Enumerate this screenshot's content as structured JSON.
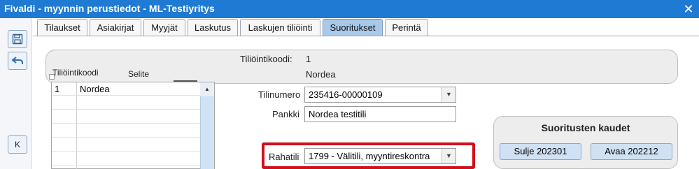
{
  "window": {
    "title": "Fivaldi - myynnin perustiedot - ML-Testiyritys"
  },
  "tabs": [
    {
      "label": "Tilaukset"
    },
    {
      "label": "Asiakirjat"
    },
    {
      "label": "Myyjät"
    },
    {
      "label": "Laskutus"
    },
    {
      "label": "Laskujen tiliöinti"
    },
    {
      "label": "Suoritukset",
      "active": true
    },
    {
      "label": "Perintä"
    }
  ],
  "left_toolbar": {
    "k_label": "K"
  },
  "header": {
    "code_label": "Tiliöintikoodi:",
    "code_value": "1",
    "name_value": "Nordea"
  },
  "grid": {
    "columns": [
      "Tiliöintikoodi",
      "Selite"
    ],
    "rows": [
      {
        "code": "1",
        "desc": "Nordea"
      }
    ]
  },
  "form": {
    "tilinumero_label": "Tilinumero",
    "tilinumero_value": "235416-00000109",
    "pankki_label": "Pankki",
    "pankki_value": "Nordea testitili",
    "rahatili_label": "Rahatili",
    "rahatili_value": "1799 - Välitili, myyntireskontra"
  },
  "periods": {
    "title": "Suoritusten kaudet",
    "close_button": "Sulje 202301",
    "open_button": "Avaa 202212"
  },
  "colors": {
    "titlebar": "#1f7ad4",
    "active_tab": "#a9c9ea",
    "highlight": "#d0101b"
  }
}
